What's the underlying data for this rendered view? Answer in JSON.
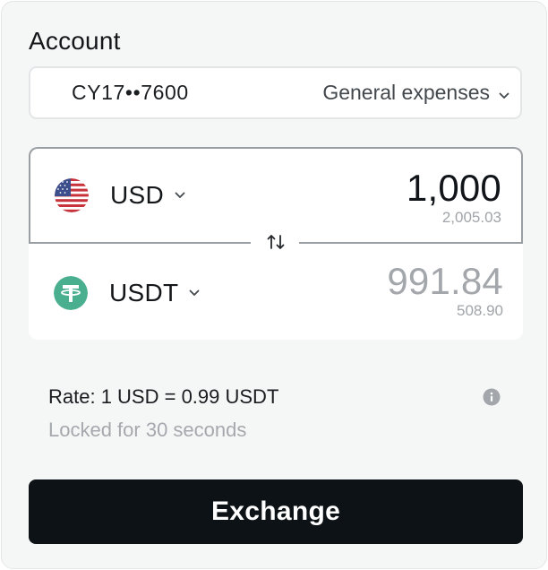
{
  "account": {
    "title": "Account",
    "number": "CY17••7600",
    "name": "General expenses",
    "icon": "chevron-down-icon"
  },
  "from": {
    "currency": "USD",
    "amount": "1,000",
    "balance": "2,005.03",
    "icon": "us-flag-icon",
    "amount_color": "#111418"
  },
  "to": {
    "currency": "USDT",
    "amount": "991.84",
    "balance": "508.90",
    "icon": "tether-icon",
    "brand_color": "#4aaf8f",
    "amount_color": "#a3a7ab"
  },
  "swap": {
    "icon": "swap-arrows-icon"
  },
  "rate": {
    "text": "Rate: 1 USD = 0.99 USDT",
    "lock_text": "Locked for 30 seconds",
    "icon": "info-icon"
  },
  "exchange_button": {
    "label": "Exchange",
    "background": "#0c1215"
  }
}
